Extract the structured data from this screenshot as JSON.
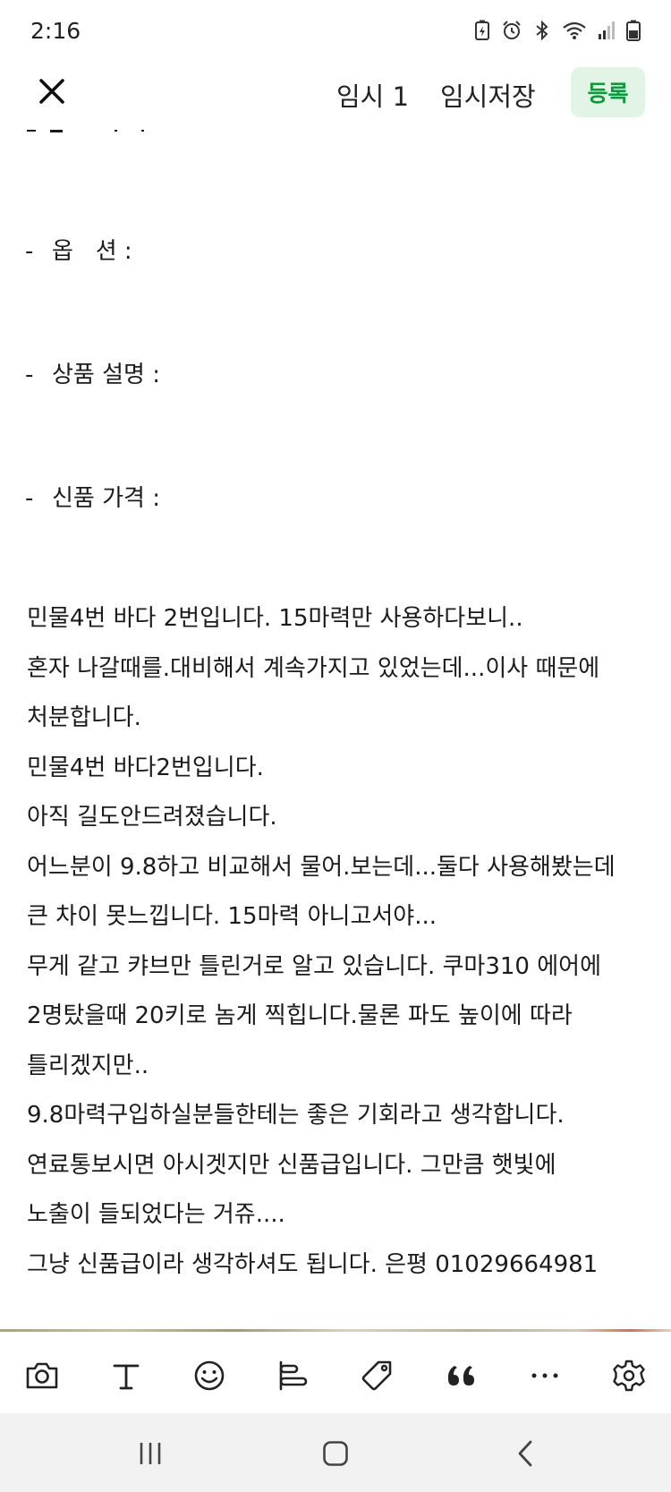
{
  "status_bar": {
    "time": "2:16",
    "icons": [
      "battery-saver-icon",
      "alarm-icon",
      "bluetooth-icon",
      "wifi-icon",
      "signal-icon",
      "battery-icon"
    ]
  },
  "header": {
    "close_icon": "close-icon",
    "temp_count": "임시 1",
    "temp_save": "임시저장",
    "register": "등록",
    "accent_color": "#0e9a3b",
    "accent_bg": "#e1f4e5"
  },
  "editor": {
    "fields": [
      {
        "dash": "-",
        "label": "옵   션 :"
      },
      {
        "dash": "-",
        "label": "상품 설명 :"
      },
      {
        "dash": "-",
        "label": "신품 가격 :"
      }
    ],
    "body_lines": [
      "민물4번 바다 2번입니다. 15마력만 사용하다보니..",
      "혼자 나갈때를.대비해서 계속가지고 있었는데...이사 때문에",
      "처분합니다.",
      "민물4번 바다2번입니다.",
      "아직 길도안드려졌습니다.",
      "어느분이 9.8하고 비교해서 물어.보는데...둘다 사용해봤는데",
      "큰 차이 못느낍니다. 15마력 아니고서야...",
      "무게 같고 캬브만 틀린거로 알고 있습니다. 쿠마310 에어에",
      "2명탔을때 20키로 놈게 찍힙니다.물론 파도 높이에 따라",
      "틀리겠지만..",
      "9.8마력구입하실분들한테는 좋은 기회라고 생각합니다.",
      "연료통보시면 아시겟지만 신품급입니다. 그만큼 햇빛에",
      "노출이 들되었다는 거쥬....",
      "그냥 신품급이라 생각하셔도 됩니다. 은평 01029664981"
    ]
  },
  "toolbar": {
    "tools": [
      "camera-icon",
      "text-icon",
      "emoji-icon",
      "align-icon",
      "tag-icon",
      "quote-icon",
      "more-icon",
      "settings-icon"
    ]
  },
  "nav_bar": {
    "buttons": [
      "recent-apps-icon",
      "home-icon",
      "back-icon"
    ]
  }
}
